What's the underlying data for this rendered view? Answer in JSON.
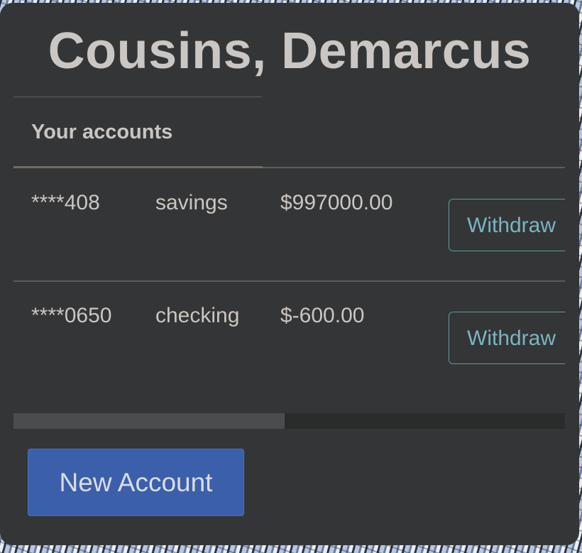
{
  "header": {
    "customer_name": "Cousins, Demarcus"
  },
  "accounts_section": {
    "heading": "Your accounts"
  },
  "accounts": [
    {
      "number": "****408",
      "type": "savings",
      "balance": "$997000.00",
      "action_label": "Withdraw"
    },
    {
      "number": "****0650",
      "type": "checking",
      "balance": "$-600.00",
      "action_label": "Withdraw"
    }
  ],
  "scrollbar": {
    "horizontal_position_fraction": 0.0,
    "visible_fraction": 0.49
  },
  "footer": {
    "new_account_label": "New Account"
  },
  "colors": {
    "card_background": "#343536",
    "text": "#c9c6c3",
    "withdraw_accent": "#7ab4c1",
    "primary_button": "#3b5fab"
  }
}
